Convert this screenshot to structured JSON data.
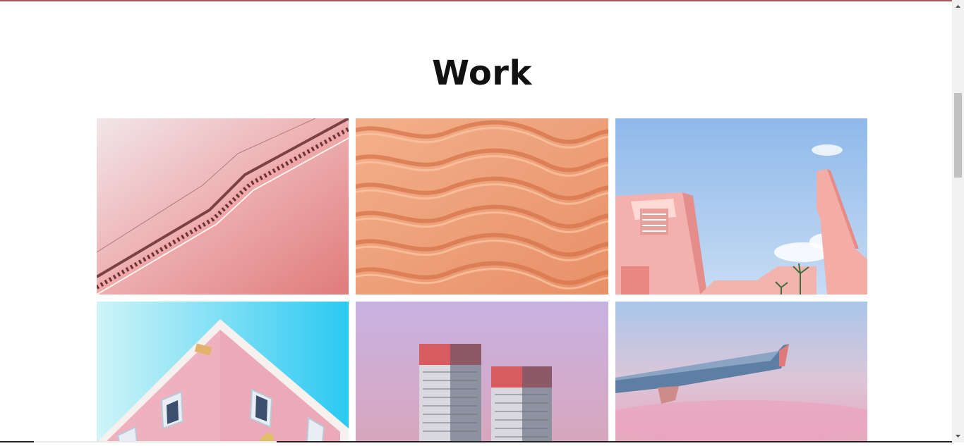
{
  "section": {
    "title": "Work"
  },
  "gallery": {
    "items": [
      {
        "name": "stair-railing",
        "icon": "pink-staircase-image"
      },
      {
        "name": "sand-dunes",
        "icon": "sand-ripples-image"
      },
      {
        "name": "pink-buildings-sky",
        "icon": "pink-architecture-image"
      },
      {
        "name": "pink-house-corner",
        "icon": "pink-house-image"
      },
      {
        "name": "twin-towers",
        "icon": "towers-image"
      },
      {
        "name": "airplane-wing",
        "icon": "wing-image"
      }
    ]
  },
  "colors": {
    "accent": "#a85560",
    "title": "#111111"
  }
}
